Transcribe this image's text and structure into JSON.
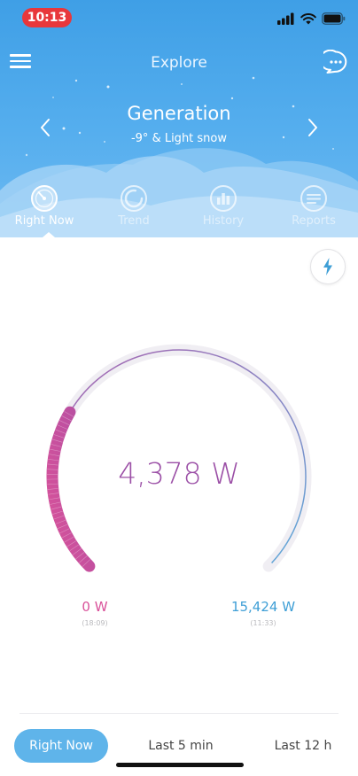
{
  "status_bar": {
    "time": "10:13"
  },
  "header": {
    "title": "Explore",
    "location": "Generation",
    "weather": "-9° & Light snow"
  },
  "nav_tabs": [
    {
      "label": "Right Now",
      "icon": "gauge-icon",
      "active": true
    },
    {
      "label": "Trend",
      "icon": "trend-ring-icon",
      "active": false
    },
    {
      "label": "History",
      "icon": "history-bars-icon",
      "active": false
    },
    {
      "label": "Reports",
      "icon": "reports-list-icon",
      "active": false
    }
  ],
  "gauge": {
    "current_value": "4,378 W",
    "min_value": "0 W",
    "min_time": "(18:09)",
    "max_value": "15,424 W",
    "max_time": "(11:33)",
    "fill_fraction": 0.28,
    "colors": {
      "track": "#f0eef3",
      "pink": "#d9529a",
      "purple": "#9b4fa6",
      "blue": "#3f9fd6"
    }
  },
  "period_tabs": [
    {
      "label": "Right Now",
      "active": true
    },
    {
      "label": "Last 5 min",
      "active": false
    },
    {
      "label": "Last 12 h",
      "active": false
    }
  ],
  "colors": {
    "header_blue": "#4aa7ec",
    "time_pill_red": "#e8373b",
    "accent_blue": "#5fb4ea"
  }
}
